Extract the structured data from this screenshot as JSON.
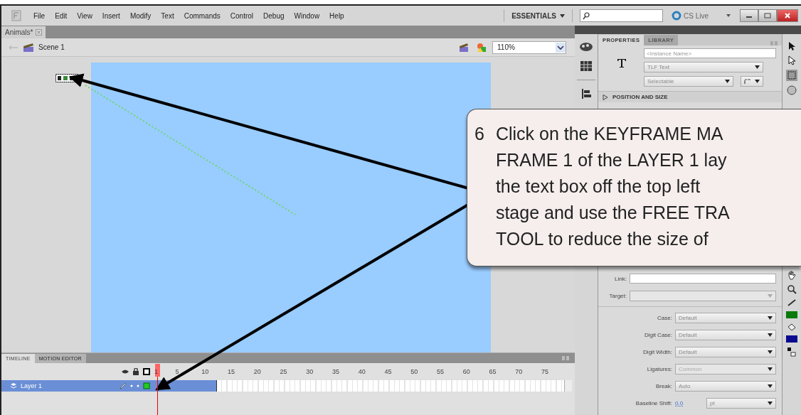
{
  "menu": [
    {
      "label": "File"
    },
    {
      "label": "Edit"
    },
    {
      "label": "View"
    },
    {
      "label": "Insert"
    },
    {
      "label": "Modify"
    },
    {
      "label": "Text"
    },
    {
      "label": "Commands"
    },
    {
      "label": "Control"
    },
    {
      "label": "Debug"
    },
    {
      "label": "Window"
    },
    {
      "label": "Help"
    }
  ],
  "workspace": "ESSENTIALS",
  "cs_live": "CS Live",
  "document_tab": "Animals*",
  "edit_bar": {
    "scene": "Scene 1",
    "zoom": "110%"
  },
  "properties": {
    "tabs": [
      {
        "label": "PROPERTIES",
        "selected": true
      },
      {
        "label": "LIBRARY",
        "selected": false
      }
    ],
    "instance_name": {
      "placeholder": "<Instance Name>"
    },
    "text_engine": "TLF Text",
    "text_type": "Selectable",
    "section": {
      "label": "POSITION AND SIZE",
      "expanded": false
    },
    "link": {
      "label": "Link:"
    },
    "target": {
      "label": "Target:",
      "disabled": true
    },
    "fields": [
      {
        "label": "Case:",
        "value": "Default",
        "disabled": false
      },
      {
        "label": "Digit Case:",
        "value": "Default",
        "disabled": false
      },
      {
        "label": "Digit Width:",
        "value": "Default",
        "disabled": false
      },
      {
        "label": "Ligatures:",
        "value": "Common",
        "disabled": true
      },
      {
        "label": "Break:",
        "value": "Auto",
        "disabled": false
      }
    ],
    "baseline_shift": {
      "label": "Baseline Shift:",
      "value": "0.0",
      "unit": "pt"
    }
  },
  "timeline": {
    "tabs": [
      {
        "label": "TIMELINE",
        "selected": true
      },
      {
        "label": "MOTION EDITOR",
        "selected": false
      }
    ],
    "frame_numbers": [
      "1",
      "5",
      "10",
      "15",
      "20",
      "25",
      "30",
      "35",
      "40",
      "45",
      "50",
      "55",
      "60",
      "65",
      "70",
      "75"
    ],
    "layers": [
      {
        "name": "Layer 1",
        "selected": true
      }
    ]
  },
  "callout": {
    "number": "6",
    "lines": [
      "Click on the KEYFRAME MA",
      "FRAME 1 of the LAYER 1 lay",
      "the text box off the top left",
      "stage and use the FREE TRA",
      "TOOL to reduce the size of"
    ]
  }
}
